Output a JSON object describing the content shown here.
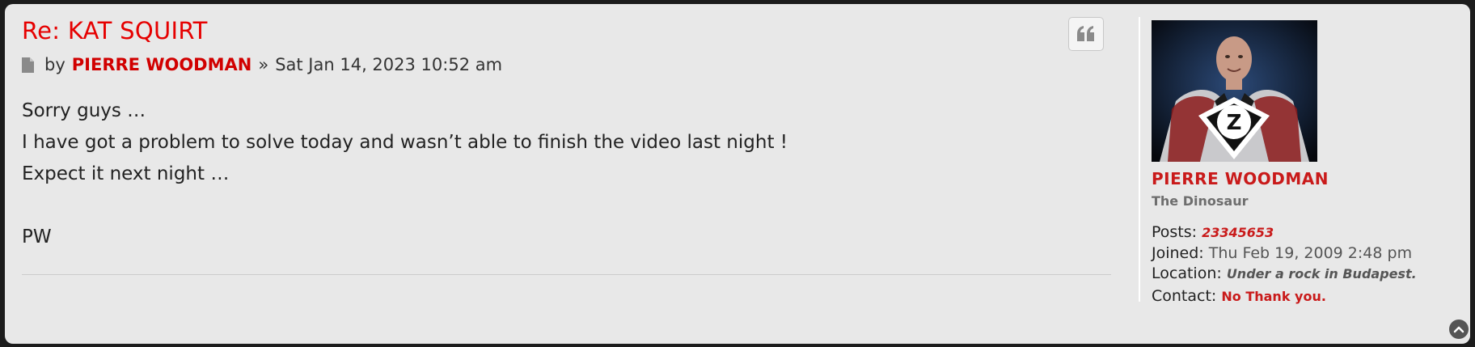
{
  "post": {
    "title": "Re: KAT SQUIRT",
    "by_label": "by",
    "author": "PIERRE WOODMAN",
    "separator": "»",
    "date": "Sat Jan 14, 2023 10:52 am",
    "content_lines": [
      "Sorry guys …",
      "I have got a problem to solve today and wasn’t able to finish the video last night !",
      "Expect it next night …",
      "",
      "PW"
    ],
    "quote_icon": "quote-icon"
  },
  "profile": {
    "avatar_icon": "avatar-image",
    "avatar_letter": "Z",
    "username": "PIERRE WOODMAN",
    "rank": "The Dinosaur",
    "posts_label": "Posts:",
    "posts_value": "23345653",
    "joined_label": "Joined:",
    "joined_value": "Thu Feb 19, 2009 2:48 pm",
    "location_label": "Location:",
    "location_value": "Under a rock in Budapest.",
    "contact_label": "Contact:",
    "contact_value": "No Thank you."
  },
  "colors": {
    "accent": "#e60000",
    "username": "#c91a1a",
    "background": "#e8e8e8"
  }
}
